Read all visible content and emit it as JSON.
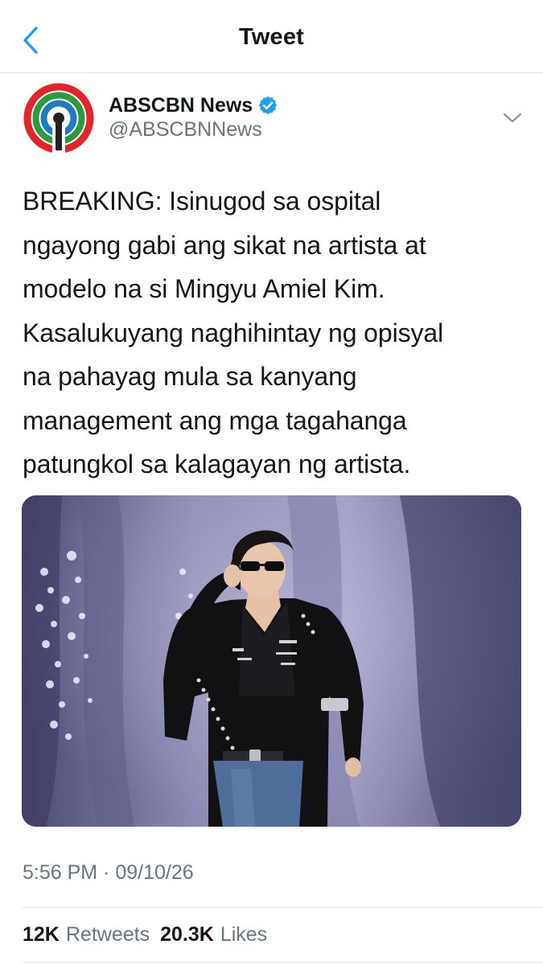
{
  "header": {
    "title": "Tweet",
    "back_icon": "chevron-left-icon",
    "accent_color": "#1da1f2"
  },
  "author": {
    "name": "ABSCBN News",
    "handle": "@ABSCBNNews",
    "verified": true,
    "verified_icon": "verified-badge-icon",
    "avatar_icon": "abscbn-logo",
    "menu_icon": "chevron-down-icon"
  },
  "tweet": {
    "text": "BREAKING: Isinugod sa ospital\nngayong gabi ang sikat na artista at\nmodelo na si Mingyu Amiel Kim.\nKasalukuyang naghihintay ng opisyal\nna pahayag mula sa kanyang\nmanagement ang mga tagahanga\npatungkol sa kalagayan ng artista.",
    "timestamp": "5:56 PM · 09/10/26"
  },
  "media": {
    "type": "photo"
  },
  "stats": {
    "retweets_count": "12K",
    "retweets_label": "Retweets",
    "likes_count": "20.3K",
    "likes_label": "Likes"
  },
  "colors": {
    "text_primary": "#14171a",
    "text_secondary": "#657786",
    "divider": "#e1e8ed",
    "verified_blue": "#1da1f2"
  }
}
